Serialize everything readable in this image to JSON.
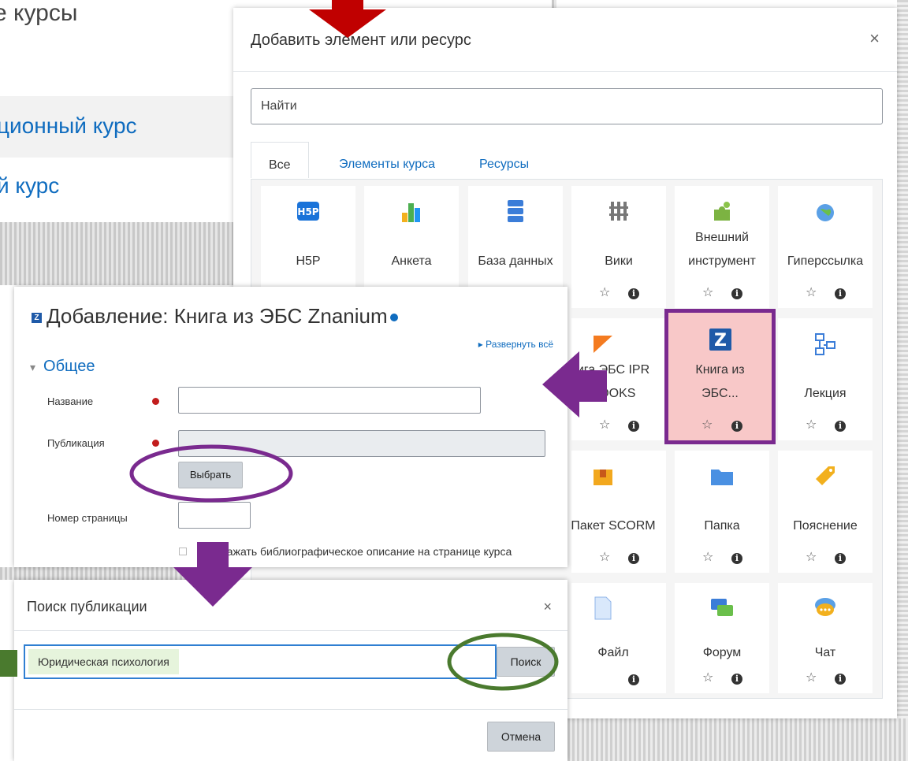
{
  "background_page": {
    "title_fragment": "е курсы",
    "row1_fragment": "ционный курс",
    "row2_fragment": "й курс"
  },
  "chooser": {
    "title": "Добавить элемент или ресурс",
    "close": "×",
    "search_placeholder": "Найти",
    "tabs": [
      "Все",
      "Элементы курса",
      "Ресурсы"
    ],
    "star_glyph": "☆",
    "info_glyph": "i",
    "tiles": [
      {
        "label": "H5P",
        "icon": "h5p-icon"
      },
      {
        "label": "Анкета",
        "icon": "survey-chart-icon"
      },
      {
        "label": "База данных",
        "icon": "database-icon"
      },
      {
        "label": "Вики",
        "icon": "wiki-icon"
      },
      {
        "label": "Внешний инструмент",
        "icon": "puzzle-icon"
      },
      {
        "label": "Гиперссылка",
        "icon": "url-globe-icon"
      },
      {
        "label": "ига ЭБС IPR BOOKS",
        "icon": "iprbooks-icon"
      },
      {
        "label": "Книга из ЭБС...",
        "icon": "znanium-icon",
        "highlighted": true
      },
      {
        "label": "Лекция",
        "icon": "lesson-icon"
      },
      {
        "label": "Пакет SCORM",
        "icon": "scorm-icon"
      },
      {
        "label": "Папка",
        "icon": "folder-icon"
      },
      {
        "label": "Пояснение",
        "icon": "label-tag-icon"
      },
      {
        "label": "Файл",
        "icon": "file-icon"
      },
      {
        "label": "Форум",
        "icon": "forum-icon"
      },
      {
        "label": "Чат",
        "icon": "chat-icon"
      }
    ]
  },
  "addform": {
    "badge": "Z",
    "title": "Добавление: Книга из ЭБС Znanium",
    "expand_all": "Развернуть всё",
    "section_caret": "▾",
    "section": "Общее",
    "name_label": "Название",
    "publication_label": "Публикация",
    "select_button": "Выбрать",
    "page_label": "Номер страницы",
    "checkbox_label": "ражать библиографическое описание на странице курса"
  },
  "search_dialog": {
    "title": "Поиск публикации",
    "close": "×",
    "query": "Юридическая психология",
    "search_button": "Поиск",
    "cancel_button": "Отмена"
  },
  "colors": {
    "link": "#0f6cbf",
    "highlight_tile": "#f8c8c8",
    "purple_annotation": "#7a2a8f",
    "green_annotation": "#4a7a2e",
    "red_arrow": "#c00000"
  }
}
